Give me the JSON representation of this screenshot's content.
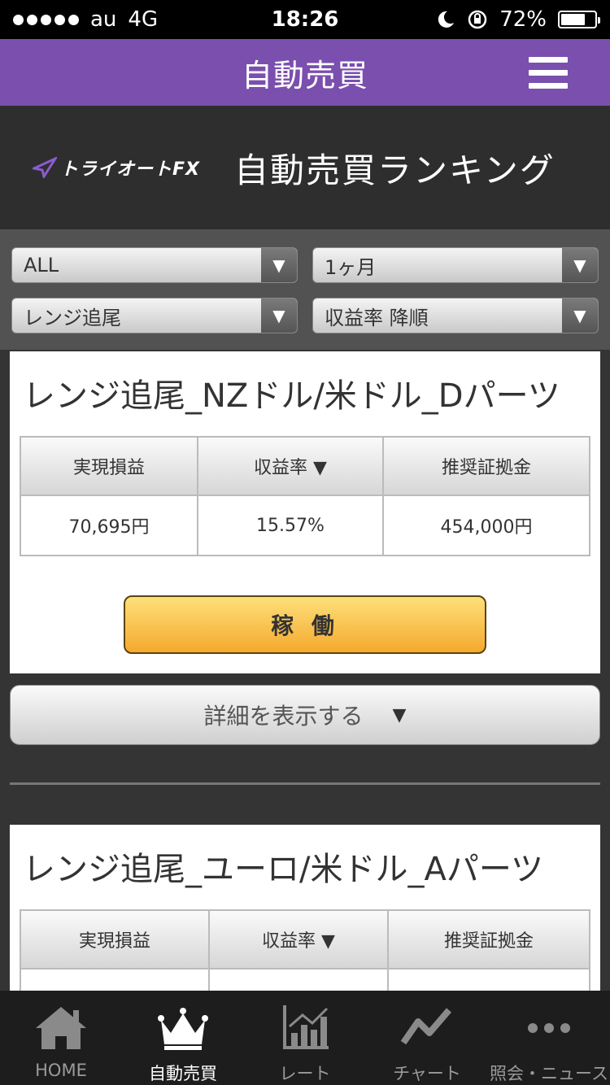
{
  "status_bar": {
    "carrier": "au",
    "network": "4G",
    "time": "18:26",
    "battery": "72%",
    "battery_level": 0.72
  },
  "nav": {
    "title": "自動売買"
  },
  "banner": {
    "brand": "トライオートFX",
    "title": "自動売買ランキング"
  },
  "filters": {
    "currency": "ALL",
    "period": "1ヶ月",
    "strategy": "レンジ追尾",
    "sort": "収益率 降順"
  },
  "table_headers": {
    "realized": "実現損益",
    "yield": "収益率 ▼",
    "margin": "推奨証拠金"
  },
  "cards": [
    {
      "title": "レンジ追尾_NZドル/米ドル_Dパーツ",
      "realized": "70,695円",
      "yield": "15.57%",
      "margin": "454,000円",
      "run_label": "稼 働"
    },
    {
      "title": "レンジ追尾_ユーロ/米ドル_Aパーツ"
    }
  ],
  "detail_button": {
    "label": "詳細を表示する",
    "arrow": "▼"
  },
  "tabs": [
    {
      "label": "HOME",
      "icon": "home-icon"
    },
    {
      "label": "自動売買",
      "icon": "crown-icon"
    },
    {
      "label": "レート",
      "icon": "rate-chart-icon"
    },
    {
      "label": "チャート",
      "icon": "line-chart-icon"
    },
    {
      "label": "照会・ニュース",
      "icon": "more-dots-icon"
    }
  ]
}
